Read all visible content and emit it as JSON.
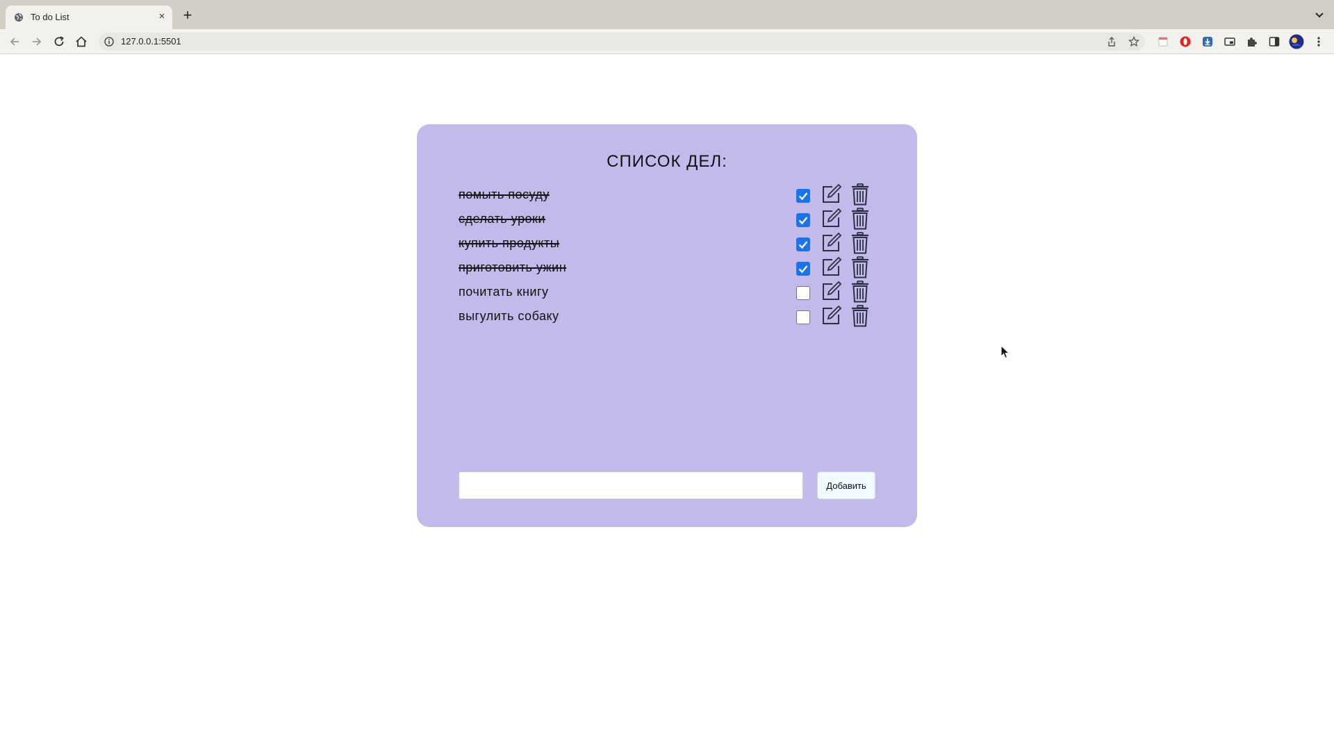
{
  "browser": {
    "tab_title": "To do List",
    "tab_close": "×",
    "new_tab": "+",
    "url": "127.0.0.1:5501"
  },
  "page": {
    "title": "СПИСОК ДЕЛ:",
    "todos": [
      {
        "text": "помыть посуду",
        "done": true
      },
      {
        "text": "сделать уроки",
        "done": true
      },
      {
        "text": "купить продукты",
        "done": true
      },
      {
        "text": "приготовить ужин",
        "done": true
      },
      {
        "text": "почитать книгу",
        "done": false
      },
      {
        "text": "выгулить собаку",
        "done": false
      }
    ],
    "input_value": "",
    "add_button": "Добавить"
  },
  "colors": {
    "card_background": "#c3b9ea",
    "checkbox_checked": "#1a73e8"
  }
}
